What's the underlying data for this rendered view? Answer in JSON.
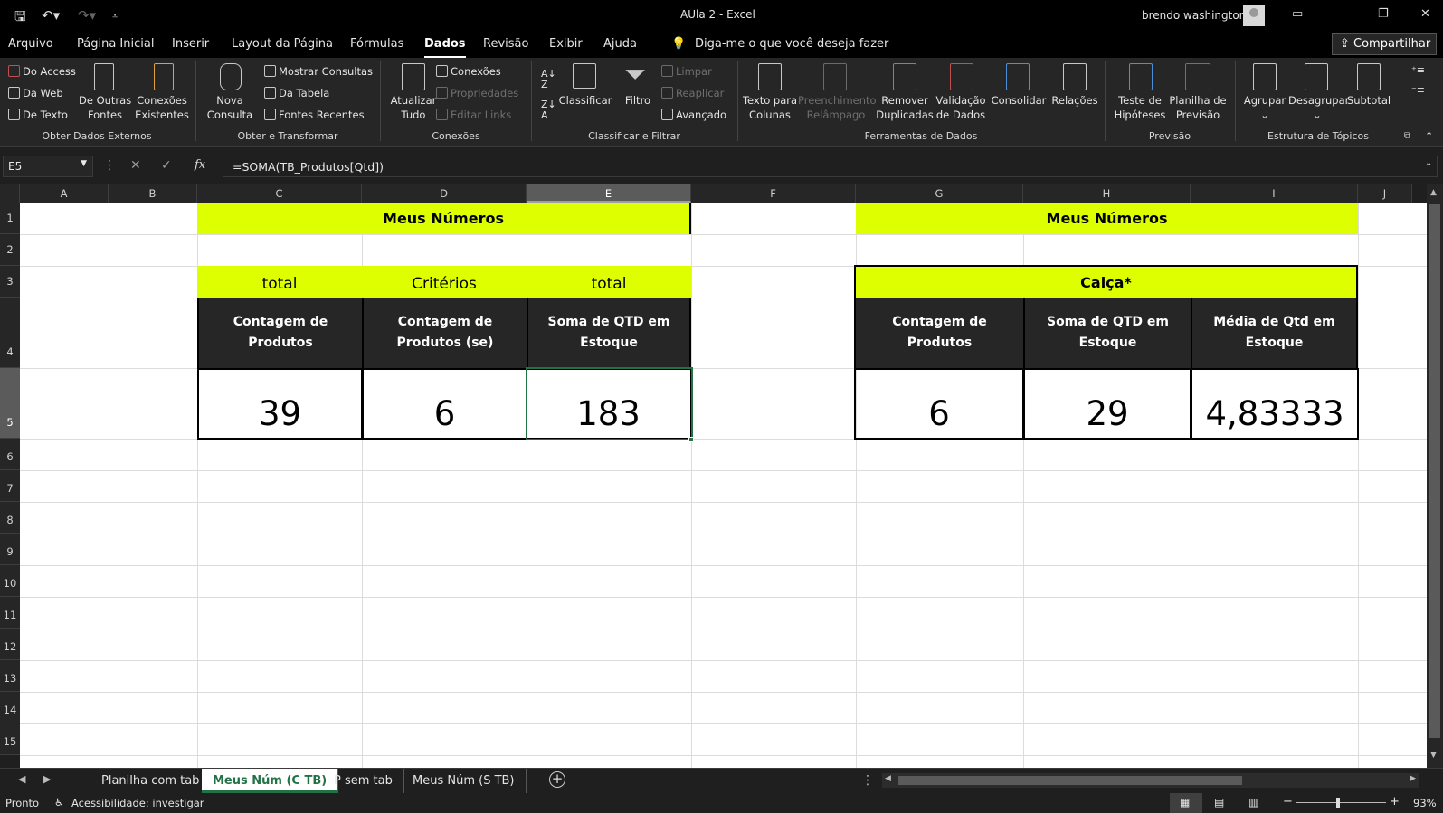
{
  "window": {
    "title": "AUla 2  -  Excel",
    "user": "brendo washington"
  },
  "menu": {
    "items": [
      "Arquivo",
      "Página Inicial",
      "Inserir",
      "Layout da Página",
      "Fórmulas",
      "Dados",
      "Revisão",
      "Exibir",
      "Ajuda"
    ],
    "active": "Dados",
    "tellme": "Diga-me o que você deseja fazer",
    "share": "Compartilhar"
  },
  "ribbon": {
    "obter_externos": {
      "access": "Do Access",
      "web": "Da Web",
      "texto": "De Texto",
      "outras1": "De Outras",
      "outras2": "Fontes",
      "conexoes1": "Conexões",
      "conexoes2": "Existentes",
      "label": "Obter Dados Externos"
    },
    "obter_transformar": {
      "nova1": "Nova",
      "nova2": "Consulta",
      "mostrar": "Mostrar Consultas",
      "tabela": "Da Tabela",
      "recentes": "Fontes Recentes",
      "label": "Obter e Transformar"
    },
    "conexoes": {
      "atualizar1": "Atualizar",
      "atualizar2": "Tudo",
      "conexoes": "Conexões",
      "propriedades": "Propriedades",
      "editar": "Editar Links",
      "label": "Conexões"
    },
    "classificar": {
      "classificar": "Classificar",
      "filtro": "Filtro",
      "limpar": "Limpar",
      "reaplicar": "Reaplicar",
      "avancado": "Avançado",
      "label": "Classificar e Filtrar"
    },
    "ferramentas": {
      "texto1": "Texto para",
      "texto2": "Colunas",
      "preench1": "Preenchimento",
      "preench2": "Relâmpago",
      "remover1": "Remover",
      "remover2": "Duplicadas",
      "valid1": "Validação",
      "valid2": "de Dados",
      "consolidar": "Consolidar",
      "relacoes": "Relações",
      "label": "Ferramentas de Dados"
    },
    "previsao": {
      "teste1": "Teste de",
      "teste2": "Hipóteses",
      "planilha1": "Planilha de",
      "planilha2": "Previsão",
      "label": "Previsão"
    },
    "topicos": {
      "agrupar": "Agrupar",
      "desagrupar": "Desagrupar",
      "subtotal": "Subtotal",
      "label": "Estrutura de Tópicos"
    }
  },
  "formula_bar": {
    "name_box": "E5",
    "formula": "=SOMA(TB_Produtos[Qtd])"
  },
  "columns": [
    "A",
    "B",
    "C",
    "D",
    "E",
    "F",
    "G",
    "H",
    "I",
    "J"
  ],
  "rows": [
    "1",
    "2",
    "3",
    "4",
    "5",
    "6",
    "7",
    "8",
    "9",
    "10",
    "11",
    "12",
    "13",
    "14",
    "15"
  ],
  "sheet": {
    "left": {
      "title": "Meus Números",
      "sub_c": "total",
      "sub_d": "Critérios",
      "sub_e": "total",
      "hdr_c": "Contagem de Produtos",
      "hdr_d": "Contagem de Produtos (se)",
      "hdr_e": "Soma de QTD em Estoque",
      "val_c": "39",
      "val_d": "6",
      "val_e": "183"
    },
    "right": {
      "title": "Meus Números",
      "sub": "Calça*",
      "hdr_g": "Contagem de Produtos",
      "hdr_h": "Soma de QTD em Estoque",
      "hdr_i": "Média de Qtd em Estoque",
      "val_g": "6",
      "val_h": "29",
      "val_i": "4,83333"
    }
  },
  "tabs": {
    "items": [
      "Planilha com tab",
      "Meus Núm (C TB)",
      "P sem tab",
      "Meus Núm (S TB)"
    ],
    "active": "Meus Núm (C TB)"
  },
  "status": {
    "mode": "Pronto",
    "accessibility": "Acessibilidade: investigar",
    "zoom": "93%"
  },
  "colors": {
    "accent_green": "#217346",
    "highlight_yellow": "#ddff00",
    "header_dark": "#262626"
  }
}
